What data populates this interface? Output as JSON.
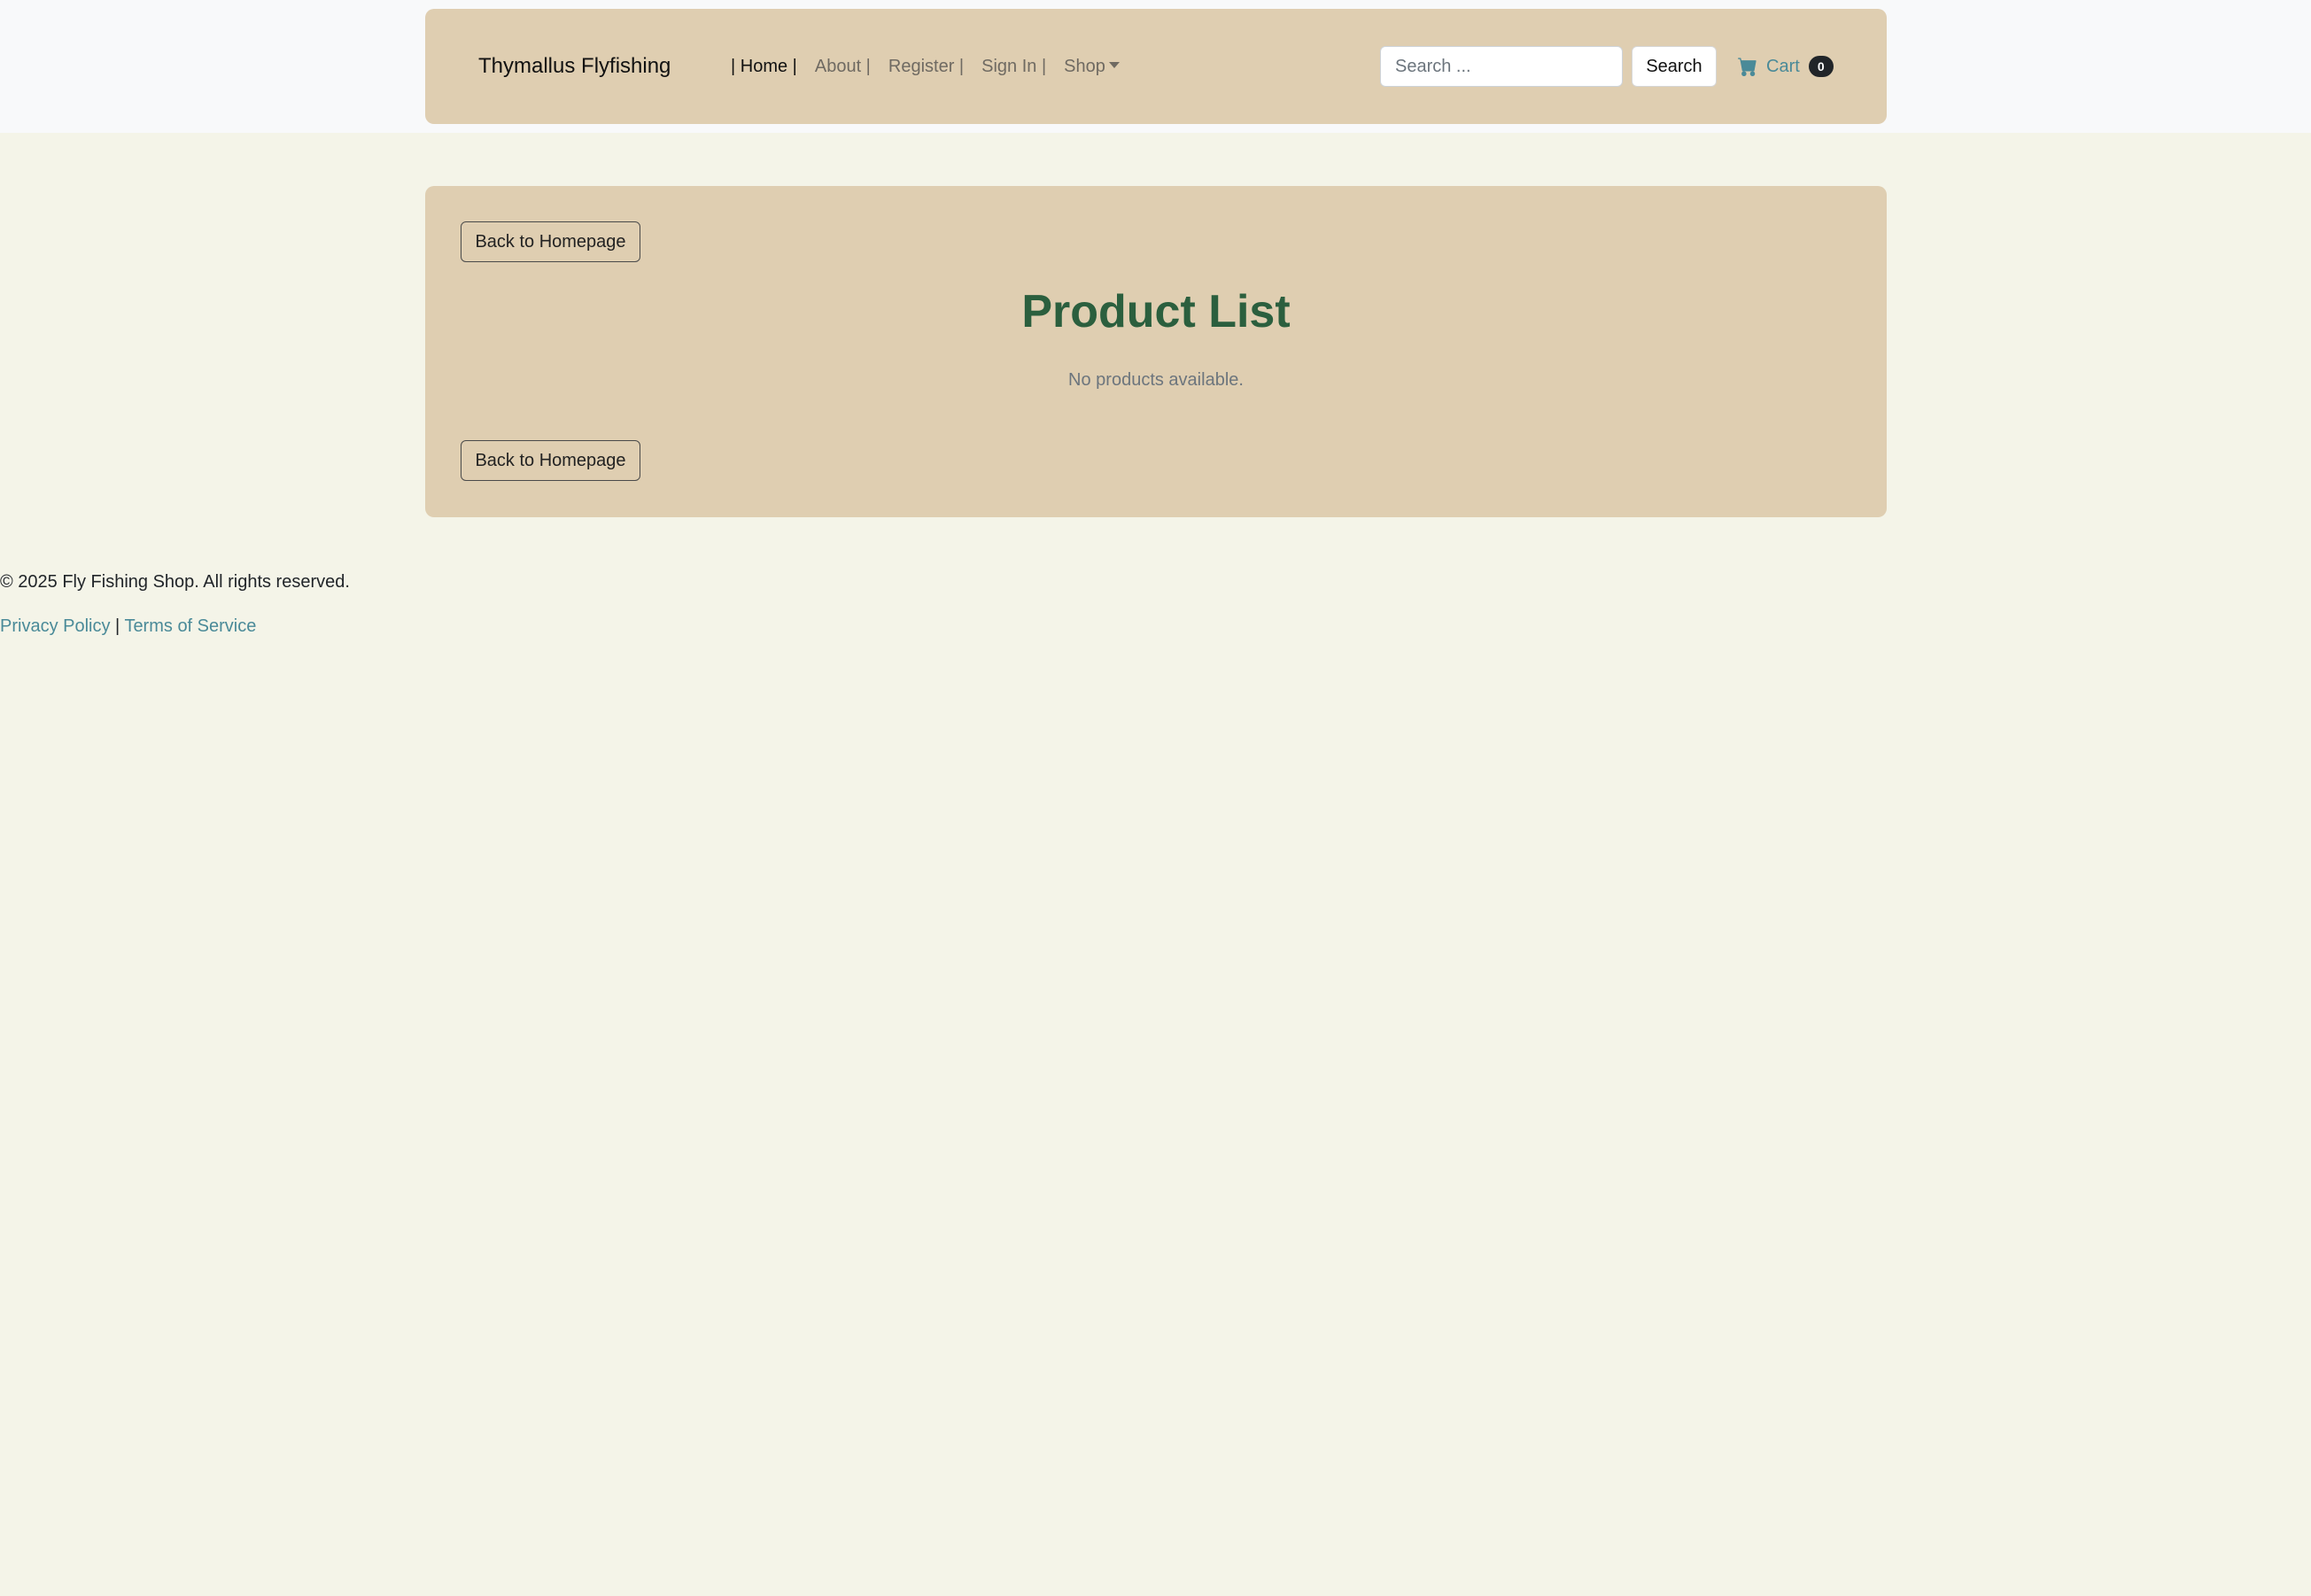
{
  "navbar": {
    "brand": "Thymallus Flyfishing",
    "links": [
      {
        "label": "| Home |",
        "active": true
      },
      {
        "label": "About |",
        "active": false
      },
      {
        "label": "Register |",
        "active": false
      },
      {
        "label": "Sign In |",
        "active": false
      },
      {
        "label": "Shop",
        "active": false
      }
    ],
    "search_placeholder": "Search ...",
    "search_button": "Search",
    "cart_label": "Cart",
    "cart_count": "0"
  },
  "main": {
    "back_button_top": "Back to Homepage",
    "title": "Product List",
    "empty_message": "No products available.",
    "back_button_bottom": "Back to Homepage"
  },
  "footer": {
    "copyright": "© 2025 Fly Fishing Shop. All rights reserved.",
    "privacy_link": "Privacy Policy",
    "separator": " | ",
    "terms_link": "Terms of Service"
  },
  "colors": {
    "page_background": "#f4f4e8",
    "panel_background": "#dfceb1",
    "title_color": "#2b5f3e",
    "link_color": "#4a8a98"
  }
}
